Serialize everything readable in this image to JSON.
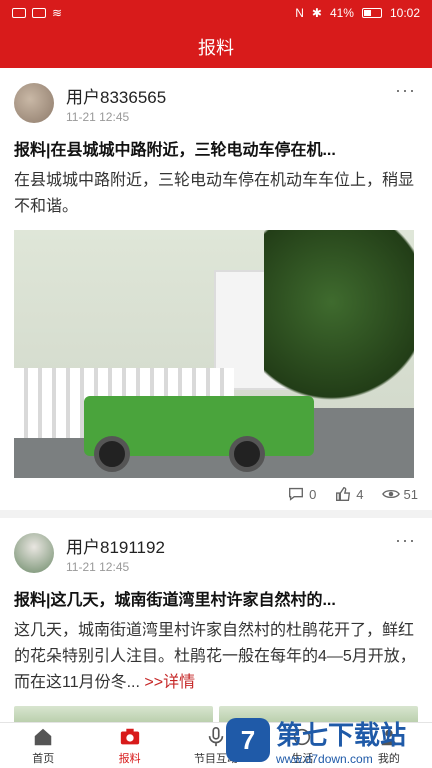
{
  "statusbar": {
    "battery_percent": "41%",
    "time": "10:02"
  },
  "header": {
    "title": "报料"
  },
  "posts": [
    {
      "user": "用户8336565",
      "time": "11-21 12:45",
      "title": "报料|在县城城中路附近，三轮电动车停在机...",
      "desc": "在县城城中路附近，三轮电动车停在机动车车位上，稍显不和谐。",
      "comments": "0",
      "likes": "4",
      "views": "51"
    },
    {
      "user": "用户8191192",
      "time": "11-21 12:45",
      "title": "报料|这几天，城南街道湾里村许家自然村的...",
      "desc": "这几天，城南街道湾里村许家自然村的杜鹃花开了，鲜红的花朵特别引人注目。杜鹃花一般在每年的4—5月开放，而在这11月份冬...",
      "more": ">>详情"
    }
  ],
  "tabbar": {
    "tabs": [
      {
        "label": "首页",
        "icon": "home-icon"
      },
      {
        "label": "报料",
        "icon": "camera-icon"
      },
      {
        "label": "节目互动",
        "icon": "microphone-icon"
      },
      {
        "label": "生活",
        "icon": "life-icon"
      },
      {
        "label": "我的",
        "icon": "user-icon"
      }
    ],
    "active_index": 1
  },
  "watermark": {
    "logo": "7",
    "title": "第七下载站",
    "url": "www.d7down.com"
  },
  "colors": {
    "brand_red": "#d81b1b",
    "link_red": "#c62828",
    "watermark_blue": "#1f5aa8"
  }
}
